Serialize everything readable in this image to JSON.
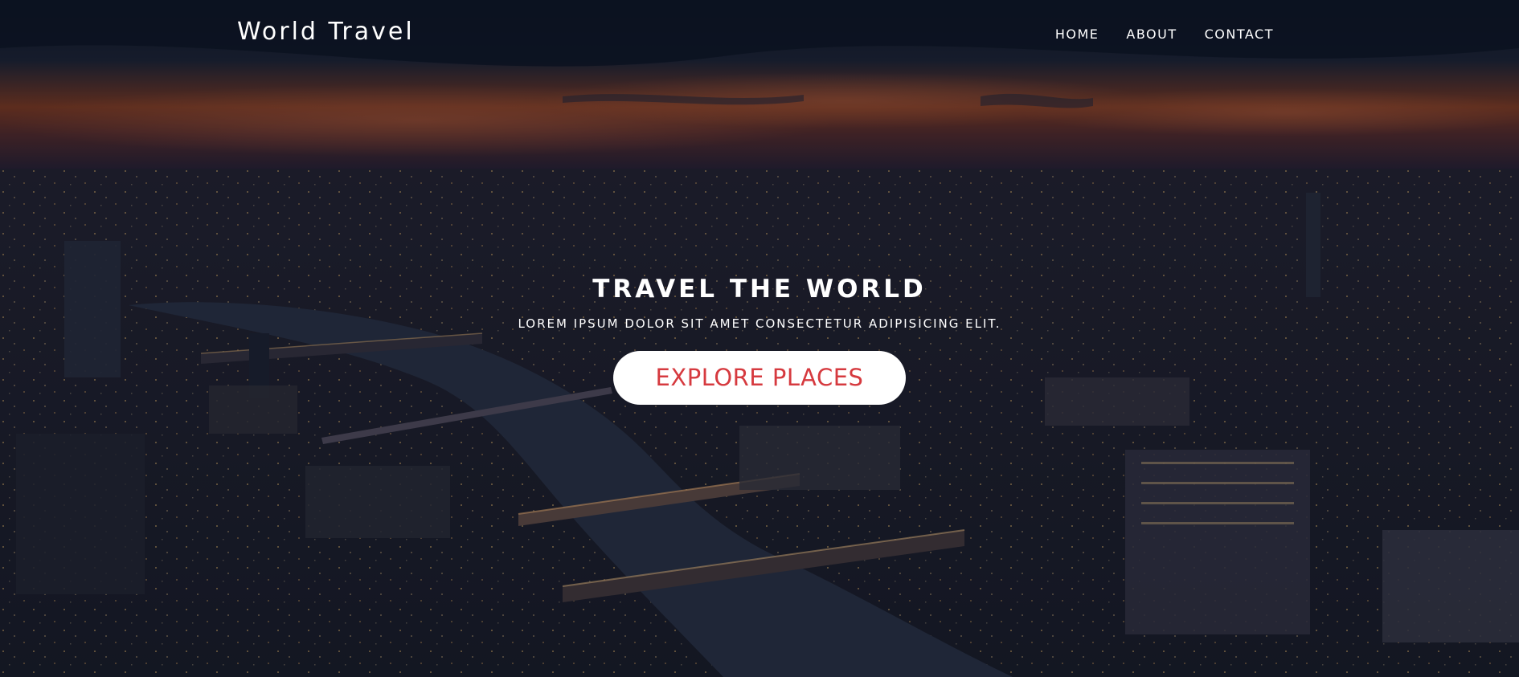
{
  "navbar": {
    "brand": "World Travel",
    "links": [
      {
        "label": "HOME"
      },
      {
        "label": "ABOUT"
      },
      {
        "label": "CONTACT"
      }
    ]
  },
  "hero": {
    "title": "TRAVEL THE WORLD",
    "subtitle": "LOREM IPSUM DOLOR SIT AMET CONSECTETUR ADIPISICING ELIT.",
    "cta_label": "EXPLORE PLACES"
  },
  "colors": {
    "cta_text": "#d63a3f",
    "cta_background": "#ffffff",
    "text": "#ffffff"
  }
}
